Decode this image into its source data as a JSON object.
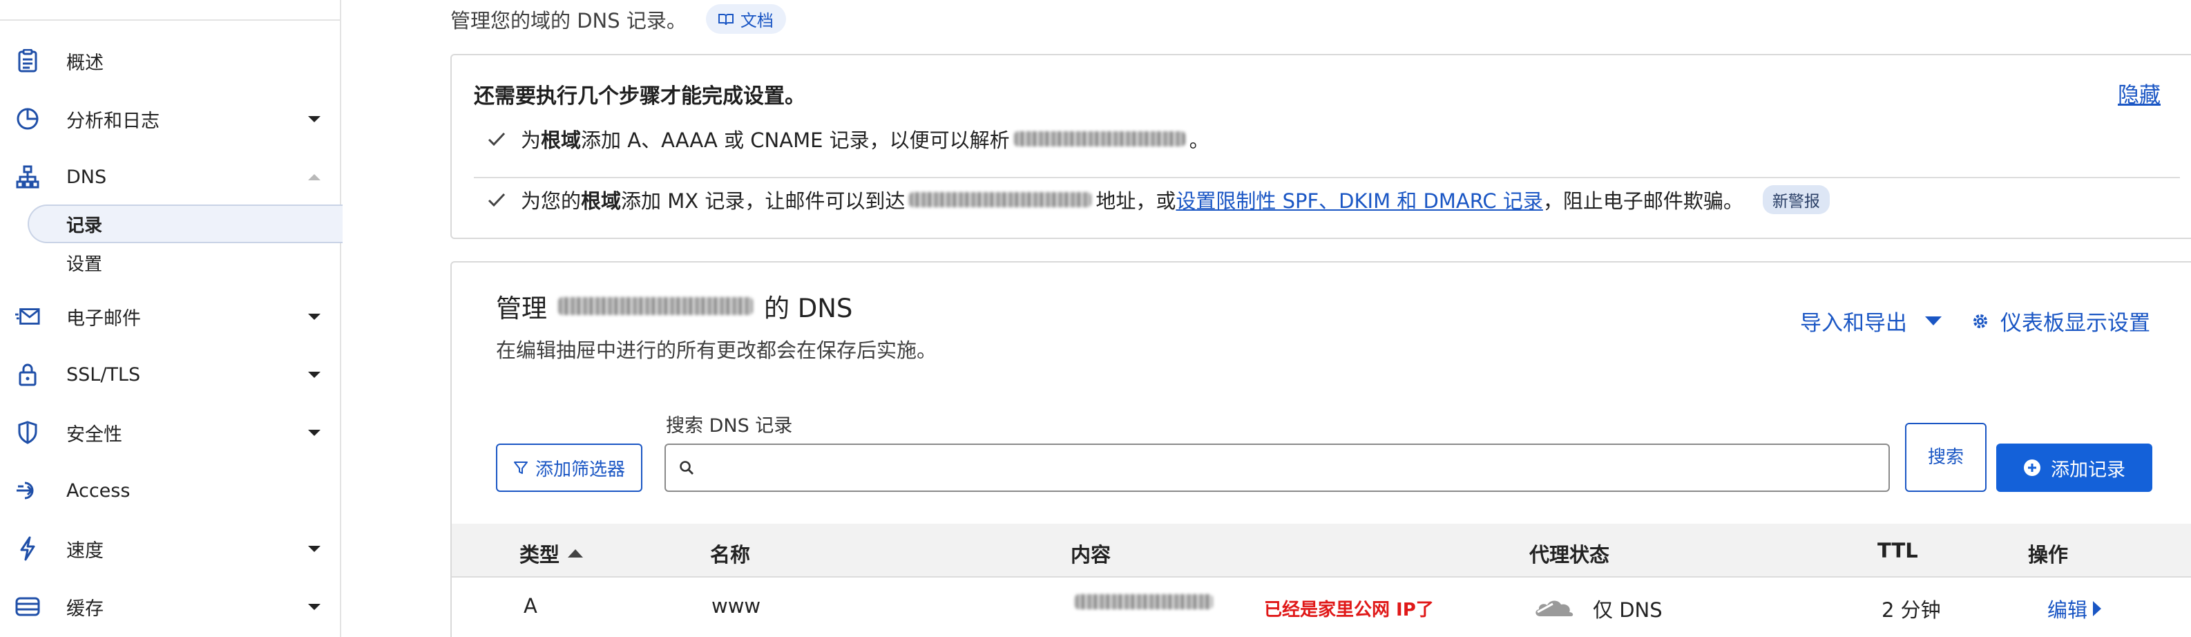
{
  "sidebar": {
    "items": [
      {
        "label": "概述",
        "icon": "clipboard-icon"
      },
      {
        "label": "分析和日志",
        "icon": "pie-chart-icon"
      },
      {
        "label": "DNS",
        "icon": "network-icon"
      },
      {
        "label": "电子邮件",
        "icon": "email-icon"
      },
      {
        "label": "SSL/TLS",
        "icon": "lock-icon"
      },
      {
        "label": "安全性",
        "icon": "shield-icon"
      },
      {
        "label": "Access",
        "icon": "access-icon"
      },
      {
        "label": "速度",
        "icon": "lightning-icon"
      },
      {
        "label": "缓存",
        "icon": "cache-icon"
      }
    ],
    "dns_sub": [
      {
        "label": "记录"
      },
      {
        "label": "设置"
      }
    ]
  },
  "intro": {
    "text": "管理您的域的 DNS 记录。",
    "doc_label": "文档"
  },
  "setup": {
    "heading": "还需要执行几个步骤才能完成设置。",
    "hide": "隐藏",
    "step1_pre": "为",
    "step1_bold": "根域",
    "step1_mid": "添加 A、AAAA 或 CNAME 记录，以便可以解析",
    "step1_post": "。",
    "step2_pre": "为您的",
    "step2_bold": "根域",
    "step2_mid": "添加 MX 记录，让邮件可以到达",
    "step2_mid2": "地址，或",
    "step2_link": "设置限制性 SPF、DKIM 和 DMARC 记录",
    "step2_post": "，阻止电子邮件欺骗。",
    "badge": "新警报"
  },
  "manage": {
    "title_pre": "管理",
    "title_post": "的 DNS",
    "subtitle": "在编辑抽屉中进行的所有更改都会在保存后实施。",
    "import_export": "导入和导出",
    "dashboard_settings": "仪表板显示设置",
    "filter_btn": "添加筛选器",
    "search_label": "搜索 DNS 记录",
    "search_placeholder": "",
    "search_btn": "搜索",
    "add_record": "添加记录"
  },
  "table": {
    "headers": [
      "类型",
      "名称",
      "内容",
      "代理状态",
      "TTL",
      "操作"
    ],
    "rows": [
      {
        "type": "A",
        "name": "www",
        "note": "已经是家里公网 IP了",
        "proxy": "仅 DNS",
        "ttl": "2 分钟",
        "action": "编辑"
      }
    ]
  },
  "colors": {
    "accent": "#1a56c4",
    "primary_button": "#1461d9",
    "note_red": "#e01818"
  }
}
